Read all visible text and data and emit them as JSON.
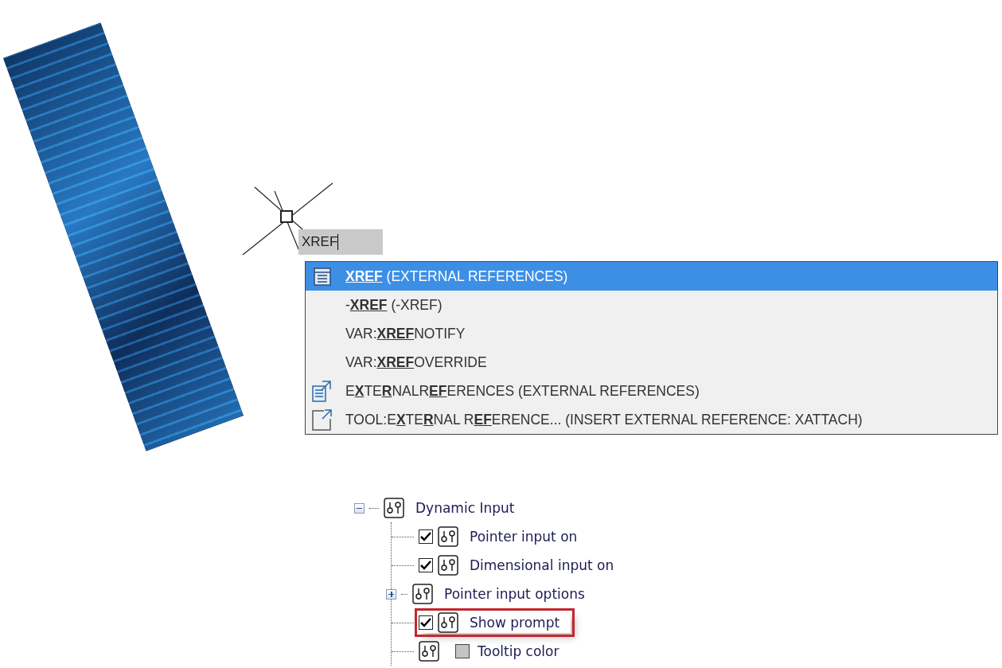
{
  "command_input": {
    "value": "XREF"
  },
  "suggestions": [
    {
      "kind": "command",
      "text": "**XREF** (EXTERNAL REFERENCES)",
      "selected": true
    },
    {
      "kind": "plain",
      "text": "-**XREF** (-XREF)",
      "selected": false
    },
    {
      "kind": "plain",
      "text": "VAR:**XREF**NOTIFY",
      "selected": false
    },
    {
      "kind": "plain",
      "text": "VAR:**XREF**OVERRIDE",
      "selected": false
    },
    {
      "kind": "palette",
      "text": "E**X**TE**R**NALR**EF**ERENCES (EXTERNAL REFERENCES)",
      "selected": false
    },
    {
      "kind": "tool",
      "text": "TOOL:E**X**TE**R**NAL R**EF**ERENCE... (INSERT EXTERNAL REFERENCE: XATTACH)",
      "selected": false
    }
  ],
  "settings_tree": {
    "label": "Dynamic Input",
    "expanded": true,
    "children": [
      {
        "kind": "toggle",
        "label": "Pointer input on",
        "checked": true,
        "highlighted": false
      },
      {
        "kind": "toggle",
        "label": "Dimensional input on",
        "checked": true,
        "highlighted": false
      },
      {
        "kind": "group",
        "label": "Pointer input options",
        "expanded": false,
        "highlighted": false
      },
      {
        "kind": "toggle",
        "label": "Show prompt",
        "checked": true,
        "highlighted": true
      },
      {
        "kind": "color",
        "label": "Tooltip color",
        "highlighted": false
      }
    ]
  }
}
